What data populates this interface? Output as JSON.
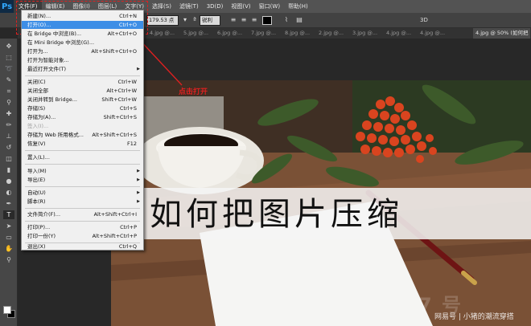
{
  "app": {
    "logo": "Ps"
  },
  "menubar": {
    "items": [
      "文件(F)",
      "编辑(E)",
      "图像(I)",
      "图层(L)",
      "文字(Y)",
      "选择(S)",
      "滤镜(T)",
      "3D(D)",
      "视图(V)",
      "窗口(W)",
      "帮助(H)"
    ]
  },
  "options_bar": {
    "font_size": "179.53 点",
    "antialias": "锐利",
    "threed": "3D"
  },
  "tabs": [
    "4.jpg @...",
    "5.jpg @...",
    "6.jpg @...",
    "7.jpg @...",
    "8.jpg @...",
    "2.jpg @...",
    "3.jpg @...",
    "4.jpg @...",
    "4.jpg @...",
    "4.jpg @ 50% (如何把"
  ],
  "file_menu": {
    "items": [
      {
        "label": "新建(N)...",
        "shortcut": "Ctrl+N"
      },
      {
        "label": "打开(O)...",
        "shortcut": "Ctrl+O",
        "highlighted": true
      },
      {
        "label": "在 Bridge 中浏览(B)...",
        "shortcut": "Alt+Ctrl+O"
      },
      {
        "label": "在 Mini Bridge 中浏览(G)...",
        "shortcut": ""
      },
      {
        "label": "打开为...",
        "shortcut": "Alt+Shift+Ctrl+O"
      },
      {
        "label": "打开为智能对象...",
        "shortcut": ""
      },
      {
        "label": "最近打开文件(T)",
        "shortcut": "",
        "submenu": true
      },
      {
        "label": "关闭(C)",
        "shortcut": "Ctrl+W"
      },
      {
        "label": "关闭全部",
        "shortcut": "Alt+Ctrl+W"
      },
      {
        "label": "关闭并转到 Bridge...",
        "shortcut": "Shift+Ctrl+W"
      },
      {
        "label": "存储(S)",
        "shortcut": "Ctrl+S"
      },
      {
        "label": "存储为(A)...",
        "shortcut": "Shift+Ctrl+S"
      },
      {
        "label": "签入(I)...",
        "shortcut": "",
        "disabled": true
      },
      {
        "label": "存储为 Web 所用格式...",
        "shortcut": "Alt+Shift+Ctrl+S"
      },
      {
        "label": "恢复(V)",
        "shortcut": "F12"
      },
      {
        "label": "置入(L)...",
        "shortcut": ""
      },
      {
        "label": "导入(M)",
        "shortcut": "",
        "submenu": true
      },
      {
        "label": "导出(E)",
        "shortcut": "",
        "submenu": true
      },
      {
        "label": "自动(U)",
        "shortcut": "",
        "submenu": true
      },
      {
        "label": "脚本(R)",
        "shortcut": "",
        "submenu": true
      },
      {
        "label": "文件简介(F)...",
        "shortcut": "Alt+Shift+Ctrl+I"
      },
      {
        "label": "打印(P)...",
        "shortcut": "Ctrl+P"
      },
      {
        "label": "打印一份(Y)",
        "shortcut": "Alt+Shift+Ctrl+P"
      },
      {
        "label": "退出(X)",
        "shortcut": "Ctrl+Q"
      }
    ]
  },
  "annotation": {
    "text": "点击打开",
    "color": "#e02020"
  },
  "canvas": {
    "banner_title": "如何把图片压缩"
  },
  "watermark": {
    "big": "7   号",
    "small": "网易号 | 小猪的潮流穿搭"
  },
  "colors": {
    "menubar": "#535353",
    "highlight": "#3d8ee6",
    "annotation": "#e02020"
  }
}
